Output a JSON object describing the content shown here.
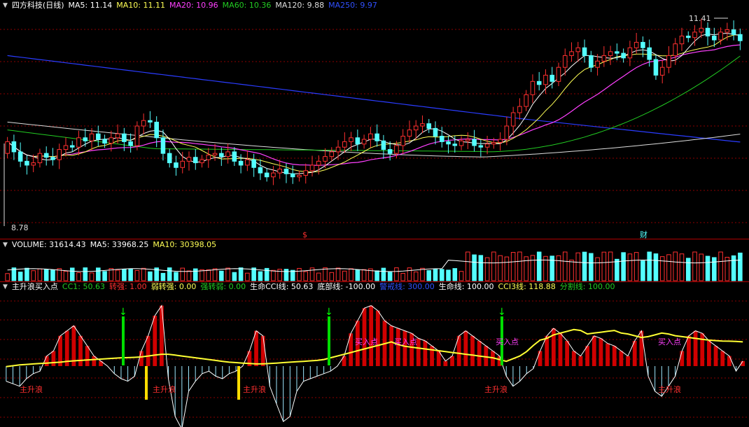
{
  "colors": {
    "up": "#ff3030",
    "down": "#54ffff",
    "ma5": "#ffffff",
    "ma10": "#ffff55",
    "ma20": "#ff40ff",
    "ma60": "#22cc22",
    "ma120": "#dddddd",
    "ma250": "#2a3cff",
    "cci": "#ffffff",
    "life": "#ffff33",
    "grid": "#8b0000"
  },
  "header": {
    "stock": "四方科技(日线)",
    "ma5": "MA5: 11.14",
    "ma10": "MA10: 11.11",
    "ma20": "MA20: 10.96",
    "ma60": "MA60: 10.36",
    "ma120": "MA120: 9.88",
    "ma250": "MA250: 9.97"
  },
  "price_chart": {
    "max_label": "11.41",
    "min_label": "8.78",
    "marker_s": "$",
    "marker_cai": "财"
  },
  "volume_header": {
    "label": "VOLUME: 31614.43",
    "ma5": "MA5: 33968.25",
    "ma10": "MA10: 30398.05"
  },
  "indicator_header": {
    "name": "主升浪买入点",
    "cc1": "CC1: 50.63",
    "zq": "转强: 1.00",
    "rzq": "弱转强: 0.00",
    "qzr": "强转弱: 0.00",
    "cci": "生命CCI线: 50.63",
    "dbx": "底部线: -100.00",
    "jjx": "警戒线: 300.00",
    "smx": "生命线: 100.00",
    "cci3": "CCI3线: 118.88",
    "fgx": "分割线: 100.00"
  },
  "indicator_labels": {
    "wave": "主升浪",
    "buy": "买入点"
  },
  "chart_data": [
    {
      "type": "candlestick",
      "title": "四方科技(日线)",
      "y_range": [
        8.78,
        11.41
      ],
      "series": [
        {
          "name": "MA5",
          "value": 11.14
        },
        {
          "name": "MA10",
          "value": 11.11
        },
        {
          "name": "MA20",
          "value": 10.96
        },
        {
          "name": "MA60",
          "value": 10.36
        },
        {
          "name": "MA120",
          "value": 9.88
        },
        {
          "name": "MA250",
          "value": 9.97
        }
      ],
      "closes": [
        9.85,
        9.72,
        9.6,
        9.55,
        9.58,
        9.7,
        9.65,
        9.62,
        9.75,
        9.8,
        9.78,
        9.9,
        9.86,
        9.95,
        9.88,
        9.83,
        9.9,
        9.95,
        9.85,
        9.8,
        10.05,
        10.12,
        10.1,
        9.9,
        9.7,
        9.58,
        9.52,
        9.6,
        9.65,
        9.58,
        9.62,
        9.68,
        9.7,
        9.66,
        9.72,
        9.6,
        9.55,
        9.62,
        9.52,
        9.45,
        9.4,
        9.45,
        9.5,
        9.44,
        9.4,
        9.42,
        9.48,
        9.55,
        9.6,
        9.66,
        9.72,
        9.78,
        9.85,
        9.9,
        9.82,
        9.88,
        9.95,
        9.86,
        9.75,
        9.7,
        9.8,
        9.92,
        10.0,
        10.05,
        10.08,
        10.02,
        9.92,
        9.85,
        9.82,
        9.8,
        9.86,
        9.88,
        9.8,
        9.78,
        9.82,
        9.84,
        9.88,
        10.05,
        10.22,
        10.3,
        10.45,
        10.62,
        10.58,
        10.7,
        10.62,
        10.8,
        10.95,
        11.0,
        11.05,
        10.95,
        10.8,
        10.88,
        10.95,
        11.0,
        10.98,
        10.92,
        11.05,
        11.12,
        11.05,
        10.9,
        10.7,
        10.8,
        10.95,
        11.1,
        11.2,
        11.18,
        11.25,
        11.3,
        11.2,
        11.15,
        11.25,
        11.28,
        11.22,
        11.14
      ],
      "opens": [
        9.7,
        9.85,
        9.72,
        9.6,
        9.55,
        9.58,
        9.7,
        9.65,
        9.62,
        9.75,
        9.8,
        9.78,
        9.9,
        9.86,
        9.95,
        9.88,
        9.83,
        9.9,
        9.95,
        9.85,
        9.8,
        10.05,
        10.12,
        10.1,
        9.9,
        9.7,
        9.58,
        9.52,
        9.6,
        9.65,
        9.58,
        9.62,
        9.68,
        9.7,
        9.66,
        9.72,
        9.6,
        9.55,
        9.62,
        9.52,
        9.45,
        9.4,
        9.45,
        9.5,
        9.44,
        9.4,
        9.42,
        9.48,
        9.55,
        9.6,
        9.66,
        9.72,
        9.78,
        9.85,
        9.9,
        9.82,
        9.88,
        9.95,
        9.86,
        9.75,
        9.7,
        9.8,
        9.92,
        10.0,
        10.05,
        10.08,
        10.02,
        9.92,
        9.85,
        9.82,
        9.8,
        9.86,
        9.88,
        9.8,
        9.78,
        9.82,
        9.84,
        9.88,
        10.05,
        10.22,
        10.3,
        10.45,
        10.62,
        10.58,
        10.7,
        10.62,
        10.8,
        10.95,
        11.0,
        11.05,
        10.95,
        10.8,
        10.88,
        10.95,
        11.0,
        10.98,
        10.92,
        11.05,
        11.12,
        11.05,
        10.9,
        10.7,
        10.8,
        10.95,
        11.1,
        11.2,
        11.18,
        11.25,
        11.3,
        11.2,
        11.15,
        11.25,
        11.28,
        11.22
      ]
    },
    {
      "type": "bar",
      "title": "VOLUME",
      "series": [
        {
          "name": "VOLUME",
          "value": 31614.43
        },
        {
          "name": "MA5",
          "value": 33968.25
        },
        {
          "name": "MA10",
          "value": 30398.05
        }
      ]
    },
    {
      "type": "bar",
      "title": "主升浪买入点",
      "series": [
        {
          "name": "CC1",
          "value": 50.63
        },
        {
          "name": "生命CCI线",
          "value": 50.63
        },
        {
          "name": "CCI3线",
          "value": 118.88
        },
        {
          "name": "警戒线",
          "value": 300.0
        },
        {
          "name": "生命线",
          "value": 100.0
        },
        {
          "name": "分割线",
          "value": 100.0
        },
        {
          "name": "底部线",
          "value": -100.0
        }
      ],
      "cc1_values": [
        -60,
        -70,
        -80,
        -50,
        -30,
        -20,
        40,
        60,
        120,
        140,
        160,
        120,
        80,
        40,
        20,
        0,
        -30,
        -50,
        -60,
        -40,
        60,
        120,
        200,
        240,
        -50,
        -200,
        -250,
        -100,
        -60,
        -30,
        -20,
        -40,
        -50,
        -30,
        -20,
        0,
        60,
        140,
        120,
        -80,
        -150,
        -220,
        -200,
        -100,
        -60,
        -50,
        -40,
        -30,
        -20,
        0,
        40,
        130,
        180,
        230,
        240,
        220,
        180,
        160,
        150,
        140,
        130,
        110,
        100,
        80,
        60,
        20,
        40,
        120,
        140,
        120,
        100,
        80,
        60,
        40,
        -40,
        -80,
        -60,
        -30,
        -10,
        60,
        120,
        150,
        130,
        100,
        60,
        40,
        80,
        120,
        110,
        90,
        80,
        60,
        40,
        100,
        140,
        -40,
        -100,
        -120,
        -80,
        -40,
        60,
        120,
        140,
        130,
        100,
        80,
        60,
        40,
        -20,
        20
      ],
      "life_values": [
        -120,
        -110,
        -100,
        -95,
        -90,
        -85,
        -80,
        -75,
        -70,
        -60,
        -55,
        -50,
        -45,
        -40,
        -35,
        -30,
        -25,
        -20,
        -18,
        -15,
        -10,
        0,
        10,
        20,
        20,
        10,
        0,
        -10,
        -20,
        -30,
        -40,
        -50,
        -60,
        -70,
        -75,
        -80,
        -85,
        -90,
        -88,
        -85,
        -80,
        -75,
        -70,
        -65,
        -60,
        -55,
        -50,
        -40,
        -20,
        0,
        20,
        40,
        60,
        80,
        100,
        120,
        140,
        160,
        130,
        110,
        100,
        90,
        80,
        70,
        60,
        50,
        40,
        30,
        20,
        10,
        0,
        -10,
        -20,
        -40,
        -60,
        -30,
        0,
        50,
        120,
        180,
        200,
        240,
        260,
        280,
        300,
        290,
        250,
        260,
        270,
        280,
        290,
        260,
        250,
        230,
        210,
        220,
        240,
        260,
        250,
        230,
        220,
        210,
        200,
        190,
        180,
        175,
        170,
        168,
        165,
        160
      ]
    }
  ]
}
